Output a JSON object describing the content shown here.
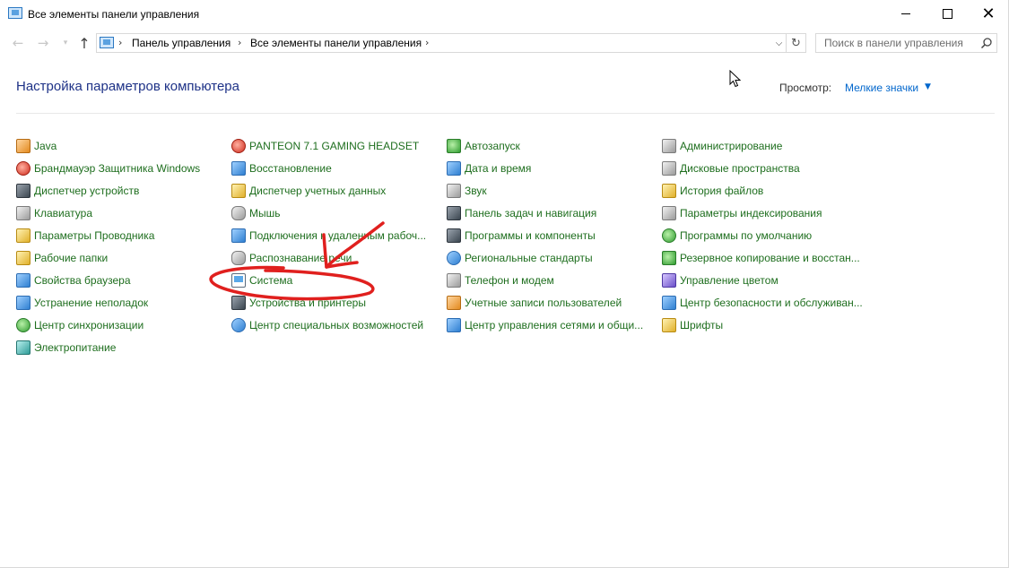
{
  "window": {
    "title": "Все элементы панели управления",
    "controls": {
      "minimize": "minimize",
      "maximize": "maximize",
      "close": "✕"
    }
  },
  "nav": {
    "back_icon": "arrow-left-icon",
    "forward_icon": "arrow-right-icon",
    "up_icon": "arrow-up-icon",
    "breadcrumb": [
      "Панель управления",
      "Все элементы панели управления"
    ],
    "search": {
      "placeholder": "Поиск в панели управления",
      "value": ""
    }
  },
  "header": {
    "title": "Настройка параметров компьютера",
    "view_label": "Просмотр:",
    "view_value": "Мелкие значки"
  },
  "items": {
    "col1": [
      {
        "label": "Java",
        "icon": "java-icon"
      },
      {
        "label": "Брандмауэр Защитника Windows",
        "icon": "firewall-icon"
      },
      {
        "label": "Диспетчер устройств",
        "icon": "device-manager-icon"
      },
      {
        "label": "Клавиатура",
        "icon": "keyboard-icon"
      },
      {
        "label": "Параметры Проводника",
        "icon": "folder-options-icon"
      },
      {
        "label": "Рабочие папки",
        "icon": "work-folders-icon"
      },
      {
        "label": "Свойства браузера",
        "icon": "internet-options-icon"
      },
      {
        "label": "Устранение неполадок",
        "icon": "troubleshooting-icon"
      },
      {
        "label": "Центр синхронизации",
        "icon": "sync-center-icon"
      },
      {
        "label": "Электропитание",
        "icon": "power-options-icon"
      }
    ],
    "col2": [
      {
        "label": "PANTEON 7.1 GAMING HEADSET",
        "icon": "headset-icon"
      },
      {
        "label": "Восстановление",
        "icon": "recovery-icon"
      },
      {
        "label": "Диспетчер учетных данных",
        "icon": "credential-manager-icon"
      },
      {
        "label": "Мышь",
        "icon": "mouse-icon"
      },
      {
        "label": "Подключения к удаленным рабоч...",
        "icon": "remoteapp-icon"
      },
      {
        "label": "Распознавание речи",
        "icon": "microphone-icon"
      },
      {
        "label": "Система",
        "icon": "system-icon"
      },
      {
        "label": "Устройства и принтеры",
        "icon": "printer-icon"
      },
      {
        "label": "Центр специальных возможностей",
        "icon": "ease-of-access-icon"
      }
    ],
    "col3": [
      {
        "label": "Автозапуск",
        "icon": "autoplay-icon"
      },
      {
        "label": "Дата и время",
        "icon": "date-time-icon"
      },
      {
        "label": "Звук",
        "icon": "sound-icon"
      },
      {
        "label": "Панель задач и навигация",
        "icon": "taskbar-icon"
      },
      {
        "label": "Программы и компоненты",
        "icon": "programs-icon"
      },
      {
        "label": "Региональные стандарты",
        "icon": "region-icon"
      },
      {
        "label": "Телефон и модем",
        "icon": "phone-modem-icon"
      },
      {
        "label": "Учетные записи пользователей",
        "icon": "user-accounts-icon"
      },
      {
        "label": "Центр управления сетями и общи...",
        "icon": "network-center-icon"
      }
    ],
    "col4": [
      {
        "label": "Администрирование",
        "icon": "admin-tools-icon"
      },
      {
        "label": "Дисковые пространства",
        "icon": "storage-spaces-icon"
      },
      {
        "label": "История файлов",
        "icon": "file-history-icon"
      },
      {
        "label": "Параметры индексирования",
        "icon": "indexing-icon"
      },
      {
        "label": "Программы по умолчанию",
        "icon": "default-programs-icon"
      },
      {
        "label": "Резервное копирование и восстан...",
        "icon": "backup-icon"
      },
      {
        "label": "Управление цветом",
        "icon": "color-management-icon"
      },
      {
        "label": "Центр безопасности и обслуживан...",
        "icon": "security-center-icon"
      },
      {
        "label": "Шрифты",
        "icon": "fonts-icon"
      }
    ]
  },
  "colors": {
    "link_green": "#1e6e1e",
    "title_blue": "#1e3287",
    "view_blue": "#0066cc",
    "annotation_red": "#e0201e"
  }
}
